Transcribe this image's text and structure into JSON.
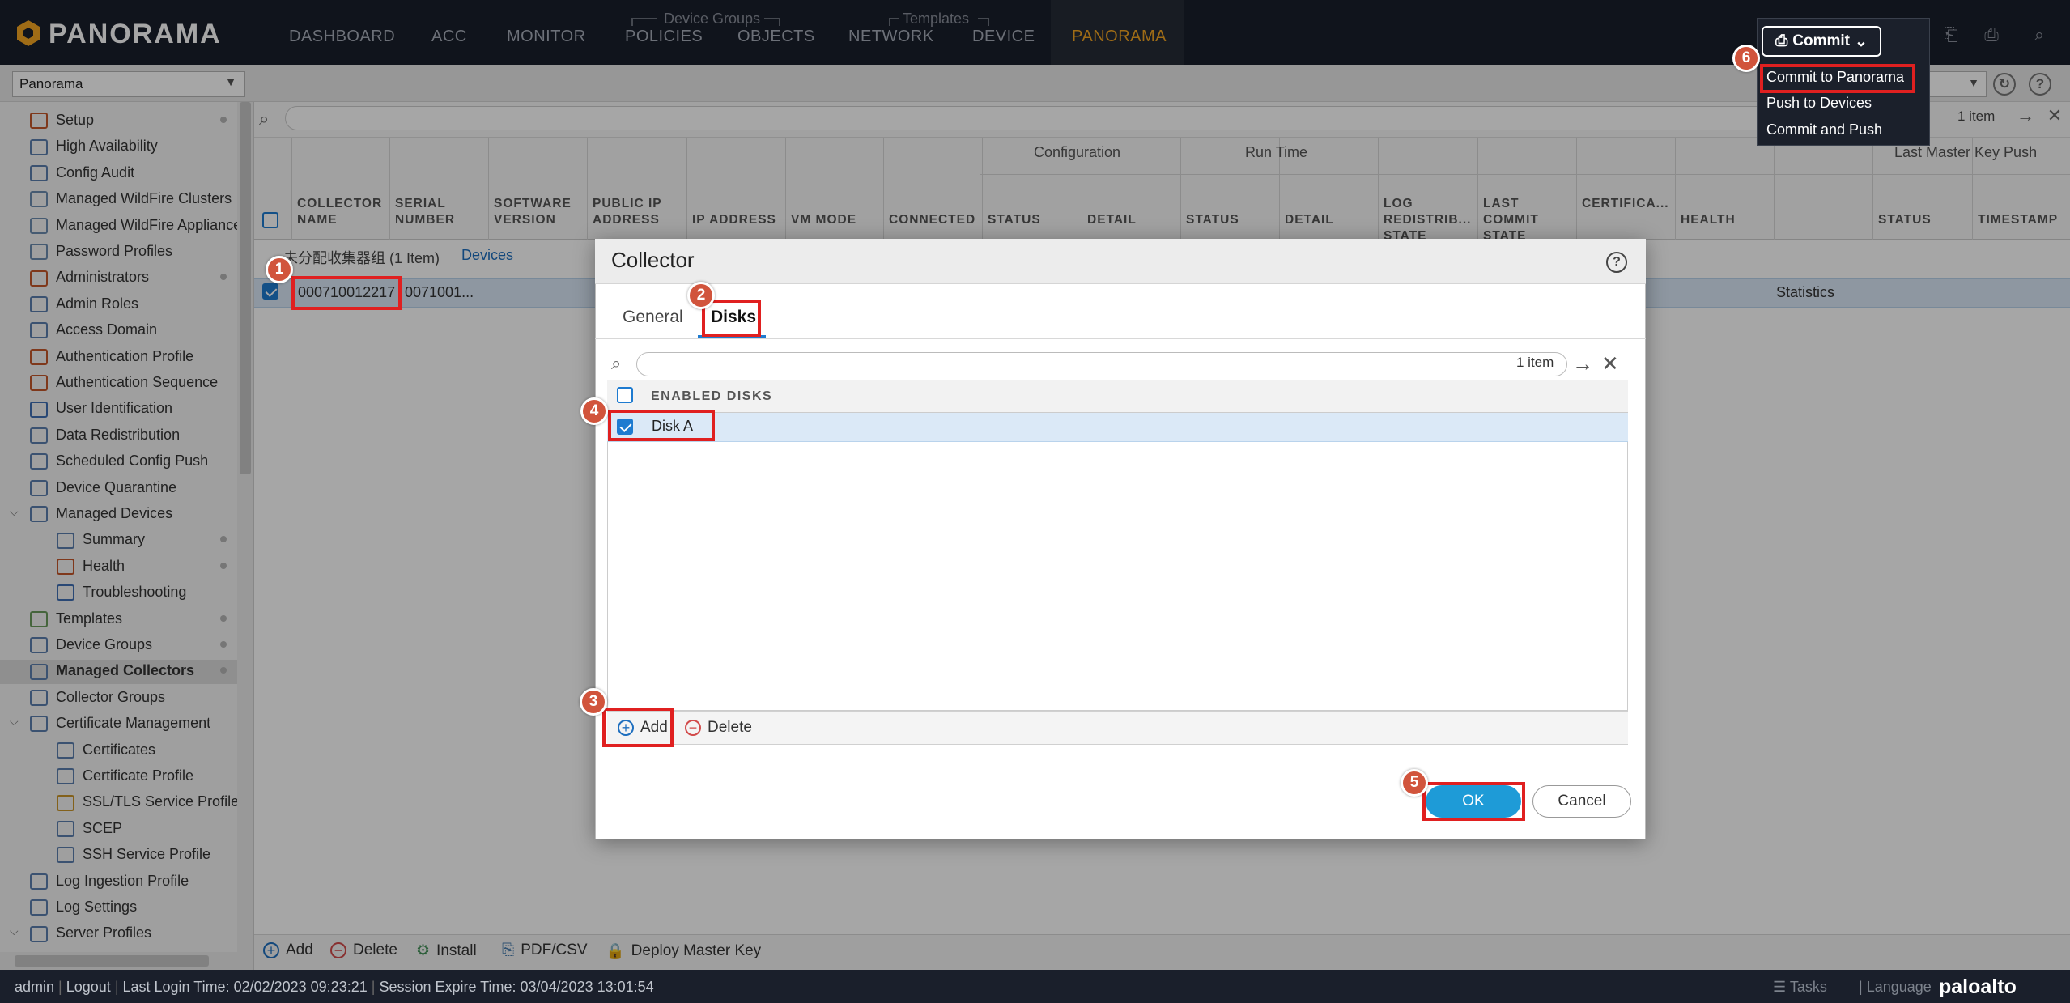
{
  "app": {
    "logo_text": "PANORAMA",
    "nav_groups": [
      "Device Groups",
      "Templates"
    ],
    "nav_tabs": [
      "DASHBOARD",
      "ACC",
      "MONITOR",
      "POLICIES",
      "OBJECTS",
      "NETWORK",
      "DEVICE",
      "PANORAMA"
    ],
    "active_tab": "PANORAMA",
    "accent_color": "#f5a623"
  },
  "commit_menu": {
    "button_label": "Commit",
    "items": [
      "Commit to Panorama",
      "Push to Devices",
      "Commit and Push"
    ]
  },
  "context_select": {
    "value": "Panorama"
  },
  "sidebar": {
    "items": [
      "Setup",
      "High Availability",
      "Config Audit",
      "Managed WildFire Clusters",
      "Managed WildFire Appliances",
      "Password Profiles",
      "Administrators",
      "Admin Roles",
      "Access Domain",
      "Authentication Profile",
      "Authentication Sequence",
      "User Identification",
      "Data Redistribution",
      "Scheduled Config Push",
      "Device Quarantine",
      "Managed Devices",
      "Summary",
      "Health",
      "Troubleshooting",
      "Templates",
      "Device Groups",
      "Managed Collectors",
      "Collector Groups",
      "Certificate Management",
      "Certificates",
      "Certificate Profile",
      "SSL/TLS Service Profile",
      "SCEP",
      "SSH Service Profile",
      "Log Ingestion Profile",
      "Log Settings",
      "Server Profiles"
    ],
    "selected": "Managed Collectors"
  },
  "table": {
    "count": "1 item",
    "group_headers": [
      "Configuration",
      "Run Time",
      "Last Master Key Push"
    ],
    "columns": [
      "COLLECTOR NAME",
      "SERIAL NUMBER",
      "SOFTWARE VERSION",
      "PUBLIC IP ADDRESS",
      "IP ADDRESS",
      "VM MODE",
      "CONNECTED",
      "STATUS",
      "DETAIL",
      "STATUS",
      "DETAIL",
      "LOG REDISTRIB... STATE",
      "LAST COMMIT STATE",
      "CERTIFICA...",
      "HEALTH",
      "STATUS",
      "TIMESTAMP"
    ],
    "group_row": {
      "label": "未分配收集器组 (1 Item)",
      "link": "Devices"
    },
    "row": {
      "collector_name": "000710012217",
      "serial": "0071001...",
      "link": "Statistics"
    }
  },
  "bottom_actions": [
    "Add",
    "Delete",
    "Install",
    "PDF/CSV",
    "Deploy Master Key"
  ],
  "status_bar": {
    "user": "admin",
    "logout": "Logout",
    "last_login": "Last Login Time: 02/02/2023 09:23:21",
    "session_expire": "Session Expire Time: 03/04/2023 13:01:54",
    "tasks": "Tasks",
    "language": "Language",
    "brand": "paloalto"
  },
  "modal": {
    "title": "Collector",
    "tabs": [
      "General",
      "Disks"
    ],
    "active_tab": "Disks",
    "count": "1 item",
    "column": "ENABLED DISKS",
    "rows": [
      "Disk A"
    ],
    "add_label": "Add",
    "delete_label": "Delete",
    "ok_label": "OK",
    "cancel_label": "Cancel"
  },
  "annotations": [
    "1",
    "2",
    "3",
    "4",
    "5",
    "6"
  ],
  "annotation_color": "#e02020"
}
